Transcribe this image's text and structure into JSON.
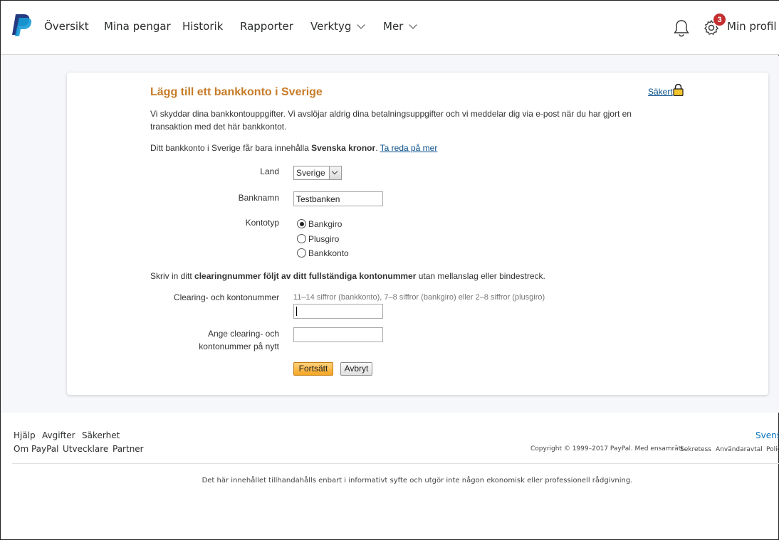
{
  "nav": {
    "items": [
      "Översikt",
      "Mina pengar",
      "Historik",
      "Rapporter",
      "Verktyg",
      "Mer"
    ],
    "notification_count": "3",
    "profile_label": "Min profil"
  },
  "form": {
    "title": "Lägg till ett bankkonto i Sverige",
    "secure_label": "Säkert",
    "intro": "Vi skyddar dina bankkontouppgifter. Vi avslöjar aldrig dina betalningsuppgifter och vi meddelar dig via e-post när du har gjort en transaktion med det här bankkontot.",
    "currency_note_pre": "Ditt bankkonto i Sverige får bara innehålla ",
    "currency_note_bold": "Svenska kronor",
    "currency_note_post": ". ",
    "learn_more": "Ta reda på mer",
    "country_label": "Land",
    "country_value": "Sverige",
    "bank_name_label": "Banknamn",
    "bank_name_value": "Testbanken",
    "account_type_label": "Kontotyp",
    "account_types": [
      "Bankgiro",
      "Plusgiro",
      "Bankkonto"
    ],
    "selected_account_type": "Bankgiro",
    "instruction_pre": "Skriv in ditt ",
    "instruction_bold": "clearingnummer följt av ditt fullständiga kontonummer",
    "instruction_post": " utan mellanslag eller bindestreck.",
    "clearing_label": "Clearing- och kontonummer",
    "clearing_hint": "11–14 siffror (bankkonto), 7–8 siffror (bankgiro) eller 2–8 siffror (plusgiro)",
    "clearing_value": "",
    "confirm_label_1": "Ange clearing- och",
    "confirm_label_2": "kontonummer på nytt",
    "confirm_value": "",
    "continue_button": "Fortsätt",
    "cancel_button": "Avbryt"
  },
  "footer": {
    "links_row1": [
      "Hjälp",
      "Avgifter",
      "Säkerhet"
    ],
    "links_row2": [
      "Om PayPal",
      "Utvecklare",
      "Partner"
    ],
    "language": "Svenska",
    "copyright": "Copyright © 1999–2017 PayPal. Med ensamrätt.",
    "legal_links": [
      "Sekretess",
      "Användaravtal",
      "Policy"
    ],
    "disclaimer": "Det här innehållet tillhandahålls enbart i informativt syfte och utgör inte någon ekonomisk eller professionell rådgivning."
  },
  "colors": {
    "accent": "#c77b27",
    "link": "#084e8a",
    "badge": "#c42e2e",
    "primary_button": "#f6a623"
  }
}
